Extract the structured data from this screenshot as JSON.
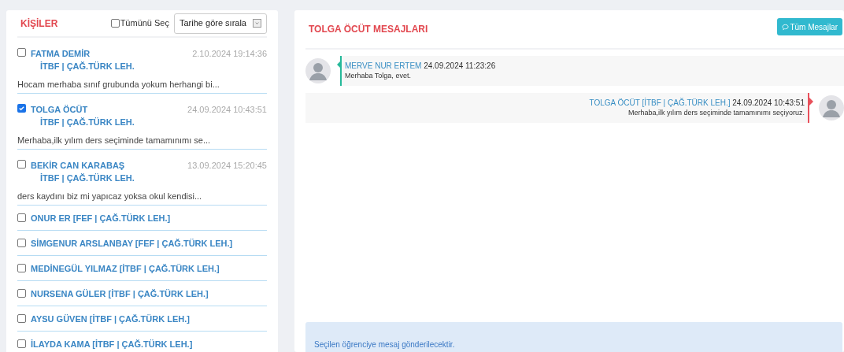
{
  "contacts_panel": {
    "title": "KİŞİLER",
    "select_all": {
      "label": "Tümünü Seç",
      "checked": false
    },
    "sort": {
      "value": "Tarihe göre sırala"
    },
    "contacts": [
      {
        "kind": "detailed",
        "name": "FATMA DEMİR",
        "department": "İTBF | ÇAĞ.TÜRK LEH.",
        "time": "2.10.2024 19:14:36",
        "preview": "Hocam merhaba sınıf grubunda yokum herhangi bi...",
        "checked": false
      },
      {
        "kind": "detailed",
        "name": "TOLGA ÖCÜT",
        "department": "İTBF | ÇAĞ.TÜRK LEH.",
        "time": "24.09.2024 10:43:51",
        "preview": "Merhaba,ilk yılım ders seçiminde tamamınımı se...",
        "checked": true
      },
      {
        "kind": "detailed",
        "name": "BEKİR CAN KARABAŞ",
        "department": "İTBF | ÇAĞ.TÜRK LEH.",
        "time": "13.09.2024 15:20:45",
        "preview": "ders kaydını biz mi yapıcaz yoksa okul kendisi...",
        "checked": false
      },
      {
        "kind": "compact",
        "name": "ONUR ER [FEF | ÇAĞ.TÜRK LEH.]",
        "checked": false
      },
      {
        "kind": "compact",
        "name": "SİMGENUR ARSLANBAY [FEF | ÇAĞ.TÜRK LEH.]",
        "checked": false
      },
      {
        "kind": "compact",
        "name": "MEDİNEGÜL YILMAZ [İTBF | ÇAĞ.TÜRK LEH.]",
        "checked": false
      },
      {
        "kind": "compact",
        "name": "NURSENA GÜLER [İTBF | ÇAĞ.TÜRK LEH.]",
        "checked": false
      },
      {
        "kind": "compact",
        "name": "AYSU GÜVEN [İTBF | ÇAĞ.TÜRK LEH.]",
        "checked": false
      },
      {
        "kind": "compact",
        "name": "İLAYDA KAMA [İTBF | ÇAĞ.TÜRK LEH.]",
        "checked": false
      }
    ]
  },
  "messages_panel": {
    "title": "TOLGA ÖCÜT MESAJLARI",
    "all_messages_button": "Tüm Mesajlar",
    "messages": [
      {
        "kind": "left",
        "sender": "MERVE NUR ERTEM",
        "time": "24.09.2024 11:23:26",
        "text": "Merhaba Tolga, evet."
      },
      {
        "kind": "right",
        "sender": "TOLGA ÖCÜT [İTBF | ÇAĞ.TÜRK LEH.]",
        "time": "24.09.2024 10:43:51",
        "text": "Merhaba,ilk yılım ders seçiminde tamamınımı seçiyoruz."
      }
    ],
    "notice": "Seçilen öğrenciye mesaj gönderilecektir."
  }
}
